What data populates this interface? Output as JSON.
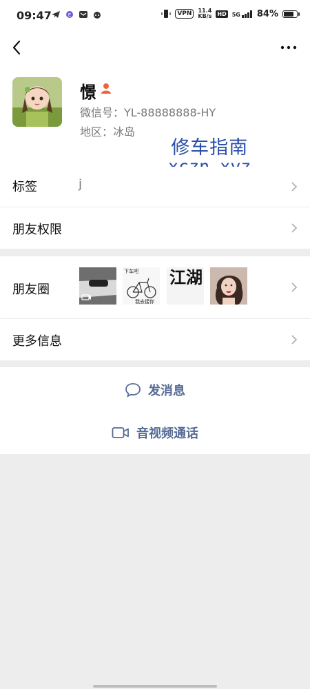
{
  "status_bar": {
    "time": "09:47",
    "vpn": "VPN",
    "net_speed_value": "11.4",
    "net_speed_unit": "KB/s",
    "hd": "HD",
    "signal_type": "5G",
    "battery_percent": "84%",
    "battery_level": 0.84
  },
  "nav": {
    "back_icon": "chevron-left-icon",
    "more_icon": "more-dots-icon"
  },
  "profile": {
    "nickname": "憬",
    "wechat_id": "微信号：YL-88888888-HY",
    "region": "地区：冰岛",
    "gender_icon": "female-icon",
    "gender_color": "#f0643c",
    "watermark_line1": "修车指南",
    "watermark_line2": "xczn.xyz"
  },
  "rows": {
    "tags_label": "标签",
    "tags_value": "j",
    "permissions_label": "朋友权限",
    "moments_label": "朋友圈",
    "more_info_label": "更多信息"
  },
  "moments_thumbs": [
    {
      "name": "moments-thumb-video",
      "caption": ""
    },
    {
      "name": "moments-thumb-bicycle",
      "caption_top": "下车吧",
      "caption_bottom": "我去接你"
    },
    {
      "name": "moments-thumb-calligraphy",
      "text": "江湖"
    },
    {
      "name": "moments-thumb-portrait",
      "caption": ""
    }
  ],
  "actions": {
    "send_message": "发消息",
    "video_call": "音视频通话",
    "accent_color": "#566b94"
  }
}
